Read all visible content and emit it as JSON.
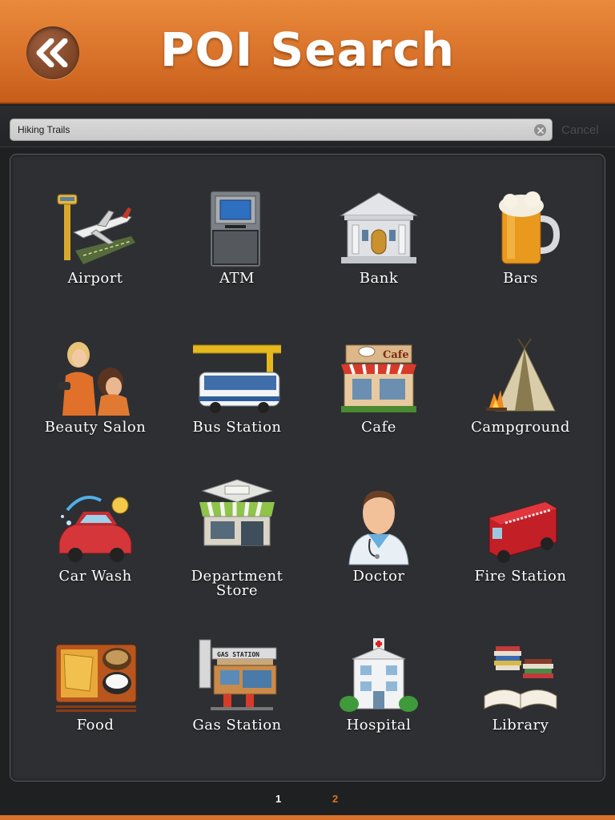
{
  "header": {
    "title": "POI Search",
    "back_icon": "double-chevron-left-icon"
  },
  "search": {
    "value": "Hiking Trails",
    "clear_icon": "clear-x-icon",
    "cancel_label": "Cancel"
  },
  "categories": [
    {
      "label": "Airport",
      "icon": "airport-icon"
    },
    {
      "label": "ATM",
      "icon": "atm-icon"
    },
    {
      "label": "Bank",
      "icon": "bank-icon"
    },
    {
      "label": "Bars",
      "icon": "beer-mug-icon"
    },
    {
      "label": "Beauty Salon",
      "icon": "beauty-salon-icon"
    },
    {
      "label": "Bus Station",
      "icon": "bus-icon"
    },
    {
      "label": "Cafe",
      "icon": "cafe-icon"
    },
    {
      "label": "Campground",
      "icon": "tent-icon"
    },
    {
      "label": "Car Wash",
      "icon": "car-wash-icon"
    },
    {
      "label": "Department Store",
      "icon": "store-icon"
    },
    {
      "label": "Doctor",
      "icon": "doctor-icon"
    },
    {
      "label": "Fire Station",
      "icon": "fire-truck-icon"
    },
    {
      "label": "Food",
      "icon": "food-tray-icon"
    },
    {
      "label": "Gas Station",
      "icon": "gas-station-icon"
    },
    {
      "label": "Hospital",
      "icon": "hospital-icon"
    },
    {
      "label": "Library",
      "icon": "books-icon"
    }
  ],
  "pagination": {
    "pages": [
      "1",
      "2"
    ],
    "current": "1"
  },
  "colors": {
    "header_orange": "#d9722a",
    "background": "#1f2022",
    "panel": "#2e2f33",
    "active_page": "#ffffff",
    "inactive_page": "#d9722a"
  }
}
